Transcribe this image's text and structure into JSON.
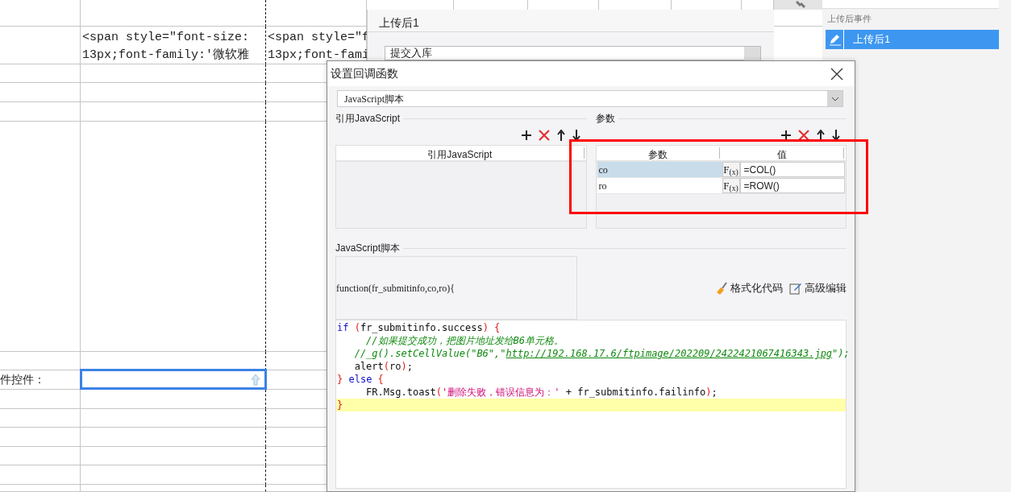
{
  "sheet": {
    "cells": [
      {
        "lines": [
          "<span style=\"font-size:",
          "13px;font-family:'微软雅"
        ]
      },
      {
        "lines": [
          "<span style=\"f",
          "13px;font-fami"
        ]
      }
    ],
    "field_label": "件控件：",
    "upload_cell": {
      "selected": true
    }
  },
  "back_panel": {
    "title": "上传后1",
    "dropdown": "提交入库"
  },
  "event_panel": {
    "section": "上传后事件",
    "items": [
      {
        "label": "上传后1",
        "selected": true
      }
    ]
  },
  "dialog": {
    "title": "设置回调函数",
    "type_select": "JavaScript脚本",
    "ref_section": "引用JavaScript",
    "ref_columns": [
      "引用JavaScript"
    ],
    "param_section": "参数",
    "param_columns": [
      "参数",
      "值"
    ],
    "params": [
      {
        "name": "co",
        "formula_button": "F$_{(x)}$",
        "value": "=COL()",
        "selected": true
      },
      {
        "name": "ro",
        "formula_button": "F$_{(x)}$",
        "value": "=ROW()",
        "selected": false
      }
    ],
    "script_section": "JavaScript脚本",
    "signature": "function(fr_submitinfo,co,ro){",
    "buttons": [
      {
        "label": "格式化代码",
        "kind": "format"
      },
      {
        "label": "高级编辑",
        "kind": "edit"
      }
    ],
    "code_lines": [
      {
        "current": false,
        "tokens": [
          {
            "kind": "keyword",
            "text": "if"
          },
          {
            "kind": "punct",
            "text": " ("
          },
          {
            "kind": "plain",
            "text": "fr_submitinfo.success"
          },
          {
            "kind": "punct",
            "text": ")"
          },
          {
            "kind": "punct",
            "text": " {"
          }
        ]
      },
      {
        "current": false,
        "tokens": [
          {
            "kind": "comment",
            "text": "     //如果提交成功，把图片地址发给B6单元格。"
          }
        ]
      },
      {
        "current": false,
        "tokens": [
          {
            "kind": "comment",
            "text": "   //_g().setCellValue(\"B6\",\""
          },
          {
            "kind": "link",
            "text": "http://192.168.17.6/ftpimage/202209/2422421067416343.jpg"
          },
          {
            "kind": "comment",
            "text": "\");"
          }
        ]
      },
      {
        "current": false,
        "tokens": [
          {
            "kind": "plain",
            "text": "   alert"
          },
          {
            "kind": "punct",
            "text": "("
          },
          {
            "kind": "plain",
            "text": "ro"
          },
          {
            "kind": "punct",
            "text": ")"
          },
          {
            "kind": "plain",
            "text": ";"
          }
        ]
      },
      {
        "current": false,
        "tokens": [
          {
            "kind": "punct",
            "text": "}"
          },
          {
            "kind": "keyword",
            "text": " else"
          },
          {
            "kind": "punct",
            "text": " {"
          }
        ]
      },
      {
        "current": false,
        "tokens": [
          {
            "kind": "plain",
            "text": "     FR.Msg.toast"
          },
          {
            "kind": "punct",
            "text": "("
          },
          {
            "kind": "string",
            "text": "'删除失败，错误信息为：'"
          },
          {
            "kind": "plain",
            "text": " + fr_submitinfo.failinfo"
          },
          {
            "kind": "punct",
            "text": ")"
          },
          {
            "kind": "plain",
            "text": ";"
          }
        ]
      },
      {
        "current": true,
        "tokens": [
          {
            "kind": "punct",
            "text": "}"
          }
        ]
      }
    ]
  }
}
